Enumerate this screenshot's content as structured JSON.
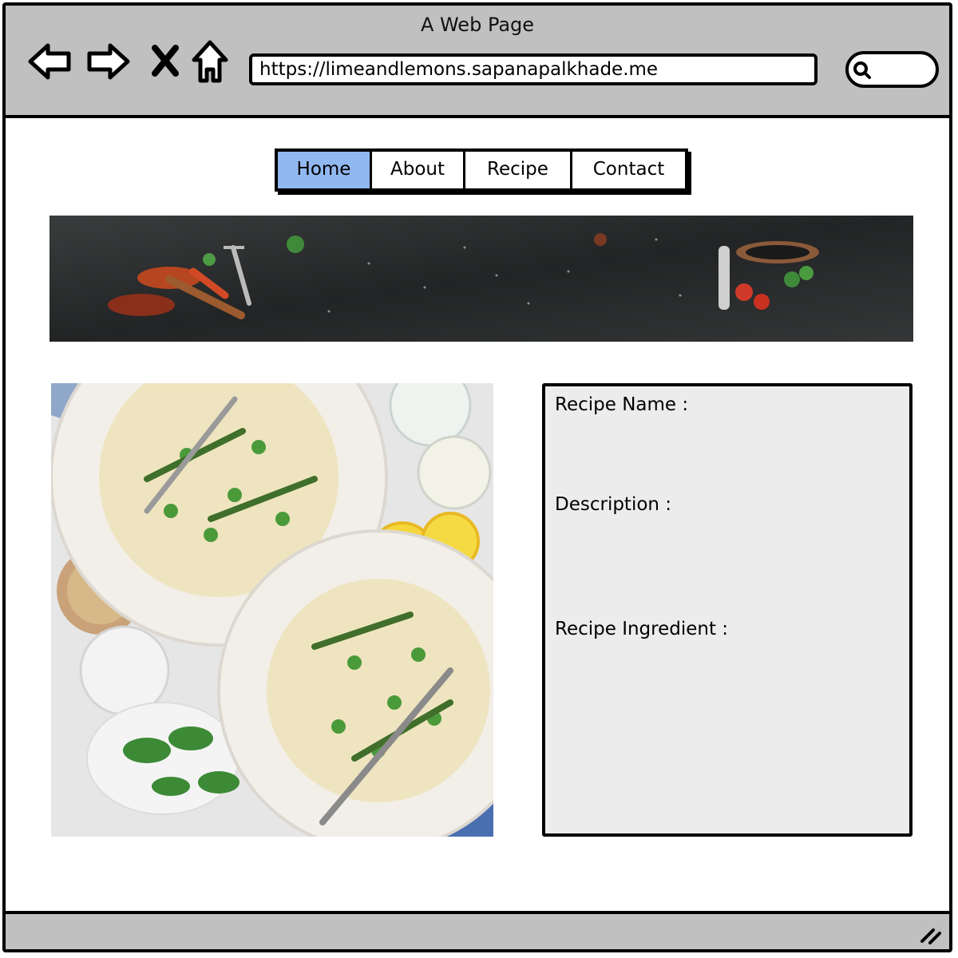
{
  "window": {
    "title": "A Web Page"
  },
  "browser": {
    "url": "https://limeandlemons.sapanapalkhade.me",
    "icons": [
      "back-arrow-icon",
      "forward-arrow-icon",
      "close-x-icon",
      "home-icon",
      "search-icon"
    ]
  },
  "menu": {
    "items": [
      {
        "label": "Home",
        "active": true
      },
      {
        "label": "About",
        "active": false
      },
      {
        "label": "Recipe",
        "active": false
      },
      {
        "label": "Contact",
        "active": false
      }
    ]
  },
  "recipe": {
    "name_label": "Recipe Name :",
    "description_label": "Description :",
    "ingredient_label": "Recipe Ingredient :"
  },
  "colors": {
    "chrome": "#c0c0c0",
    "active_tab": "#91b8f0",
    "panel": "#ececec",
    "banner": "#2b2d2e"
  }
}
